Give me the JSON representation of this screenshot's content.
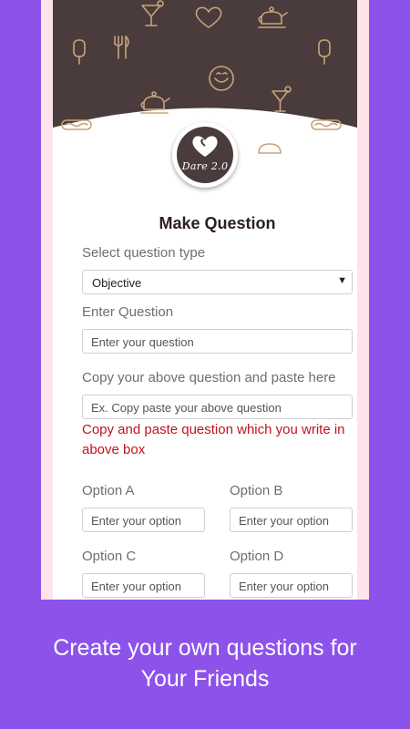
{
  "app": {
    "logo_text": "Dare 2.0",
    "colors": {
      "background": "#8d52ea",
      "header": "#4a3c3c",
      "icon": "#c9a37a",
      "error": "#c1121f"
    }
  },
  "hero": {
    "icons": [
      "cocktail-icon",
      "heart-icon",
      "teapot-icon",
      "ice-cream-icon",
      "fork-knife-icon",
      "smiley-icon",
      "cocktail-icon",
      "teapot-icon",
      "hotdog-icon",
      "ice-cream-icon",
      "hotdog-icon",
      "cake-icon"
    ]
  },
  "form": {
    "title": "Make Question",
    "type_label": "Select question type",
    "type_value": "Objective",
    "question_label": "Enter Question",
    "question_placeholder": "Enter your question",
    "copy_label": "Copy your above question and paste here",
    "copy_placeholder": "Ex. Copy paste your above question",
    "error_text": "Copy and paste question which you write in above box",
    "options": [
      {
        "label": "Option A",
        "placeholder": "Enter your option"
      },
      {
        "label": "Option B",
        "placeholder": "Enter your option"
      },
      {
        "label": "Option C",
        "placeholder": "Enter your option"
      },
      {
        "label": "Option D",
        "placeholder": "Enter your option"
      }
    ]
  },
  "caption": {
    "line1": "Create your own questions for",
    "line2": "Your Friends"
  }
}
